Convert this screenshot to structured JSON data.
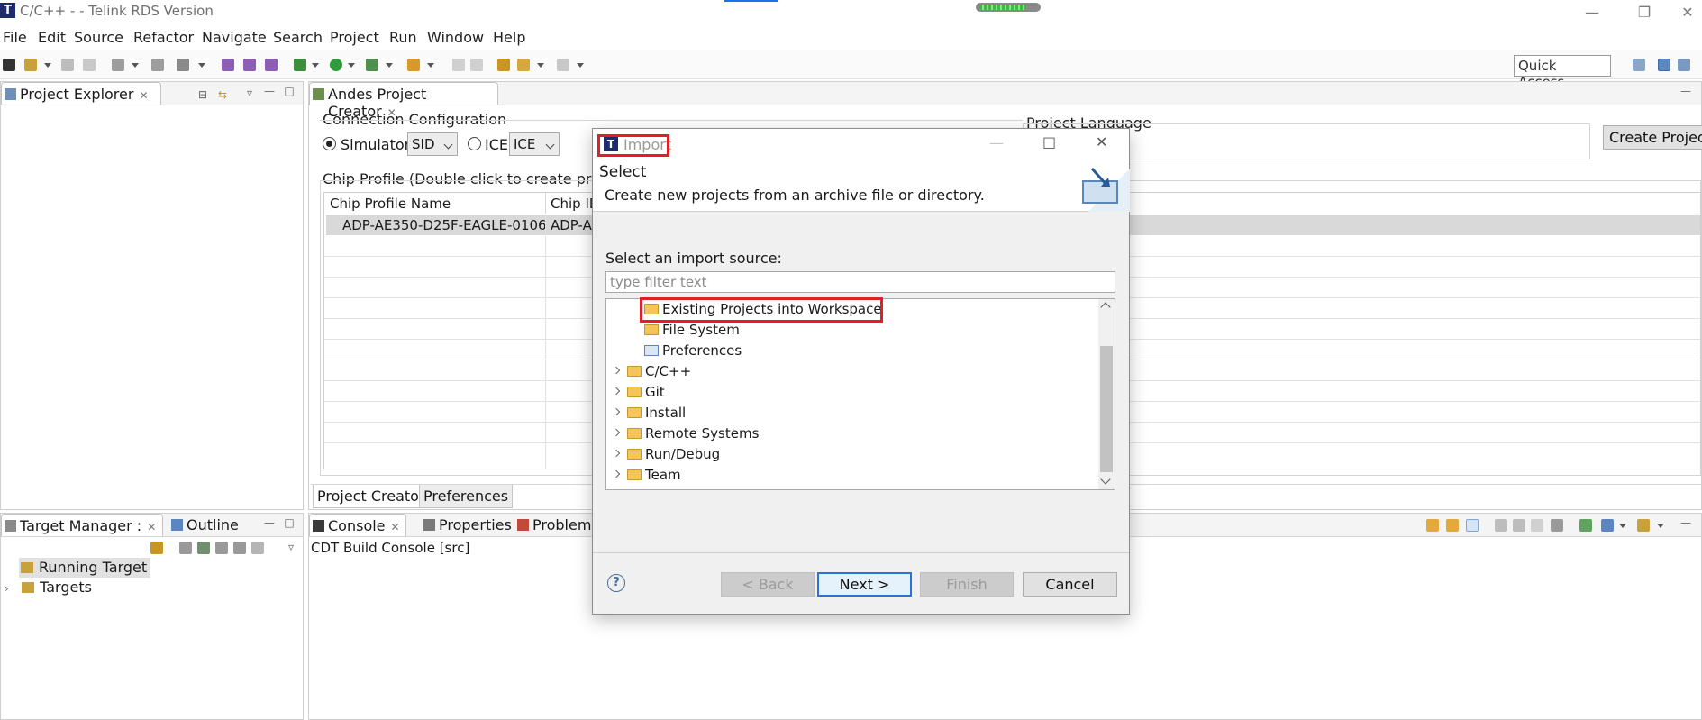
{
  "window": {
    "title": "C/C++ - - Telink RDS Version",
    "logo_letter": "T",
    "controls": [
      "minimize",
      "restore",
      "close"
    ]
  },
  "menu": [
    "File",
    "Edit",
    "Source",
    "Refactor",
    "Navigate",
    "Search",
    "Project",
    "Run",
    "Window",
    "Help"
  ],
  "toolbar": {
    "quick_access": "Quick Access"
  },
  "project_explorer": {
    "tab_label": "Project Explorer"
  },
  "editor": {
    "tab_label": "Andes Project Creator",
    "connection_label": "Connection Configuration",
    "simulator_label": "Simulator",
    "simulator_value": "SID",
    "ice_label": "ICE",
    "ice_value": "ICE",
    "project_language_label": "Project Language",
    "create_button": "Create Project",
    "chip_profile_label": "Chip Profile (Double click to create projec",
    "columns": [
      "Chip Profile Name",
      "Chip ID"
    ],
    "rows": [
      {
        "name": "ADP-AE350-D25F-EAGLE-0106",
        "id": "ADP-A"
      }
    ],
    "bottom_tabs": [
      "Project Creator",
      "Preferences"
    ]
  },
  "target_manager": {
    "tab_label": "Target Manager :",
    "outline_label": "Outline",
    "items": [
      "Running Target",
      "Targets"
    ]
  },
  "console": {
    "tabs": [
      "Console",
      "Properties",
      "Problems"
    ],
    "text": "CDT Build Console [src]"
  },
  "dialog": {
    "title": "Import",
    "heading": "Select",
    "description": "Create new projects from an archive file or directory.",
    "source_label": "Select an import source:",
    "filter_placeholder": "type filter text",
    "child_items": [
      "Existing Projects into Workspace",
      "File System",
      "Preferences"
    ],
    "folders": [
      "C/C++",
      "Git",
      "Install",
      "Remote Systems",
      "Run/Debug",
      "Team"
    ],
    "buttons": {
      "back": "< Back",
      "next": "Next >",
      "finish": "Finish",
      "cancel": "Cancel"
    },
    "help": "?"
  },
  "colors": {
    "highlight": "#e21f26",
    "accent": "#2b72d7",
    "brand": "#1c2d6b"
  }
}
